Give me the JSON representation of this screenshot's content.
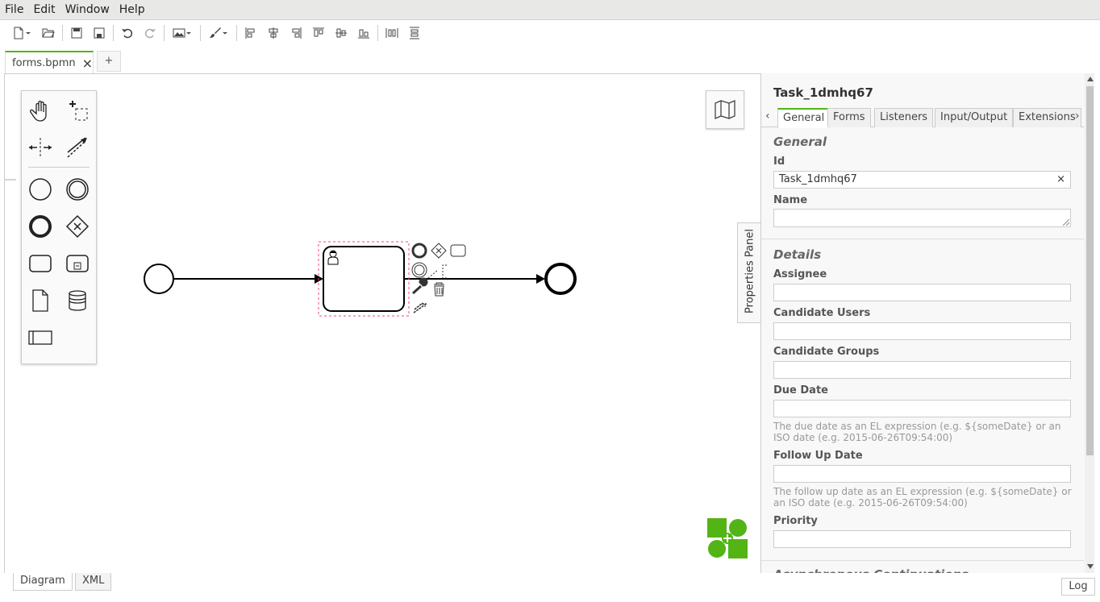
{
  "menu": [
    "File",
    "Edit",
    "Window",
    "Help"
  ],
  "tabs": {
    "file": "forms.bpmn",
    "close": "×",
    "add": "+"
  },
  "properties_toggle": "Properties Panel",
  "panel": {
    "title": "Task_1dmhq67",
    "tabs": [
      "General",
      "Forms",
      "Listeners",
      "Input/Output",
      "Extensions"
    ],
    "prev_arrow": "‹",
    "next_arrow": "›",
    "general_section": "General",
    "id_label": "Id",
    "id_value": "Task_1dmhq67",
    "clear": "×",
    "name_label": "Name",
    "name_value": "",
    "details_section": "Details",
    "assignee_label": "Assignee",
    "candidate_users_label": "Candidate Users",
    "candidate_groups_label": "Candidate Groups",
    "due_date_label": "Due Date",
    "due_date_help": "The due date as an EL expression (e.g. ${someDate} or an ISO date (e.g. 2015-06-26T09:54:00)",
    "follow_up_label": "Follow Up Date",
    "follow_up_help": "The follow up date as an EL expression (e.g. ${someDate} or an ISO date (e.g. 2015-06-26T09:54:00)",
    "priority_label": "Priority",
    "cut_off_section": "Asynchronous Continuations"
  },
  "bottom": {
    "diagram": "Diagram",
    "xml": "XML",
    "log": "Log"
  },
  "colors": {
    "accent": "#52b415",
    "selection": "#ff4081"
  }
}
